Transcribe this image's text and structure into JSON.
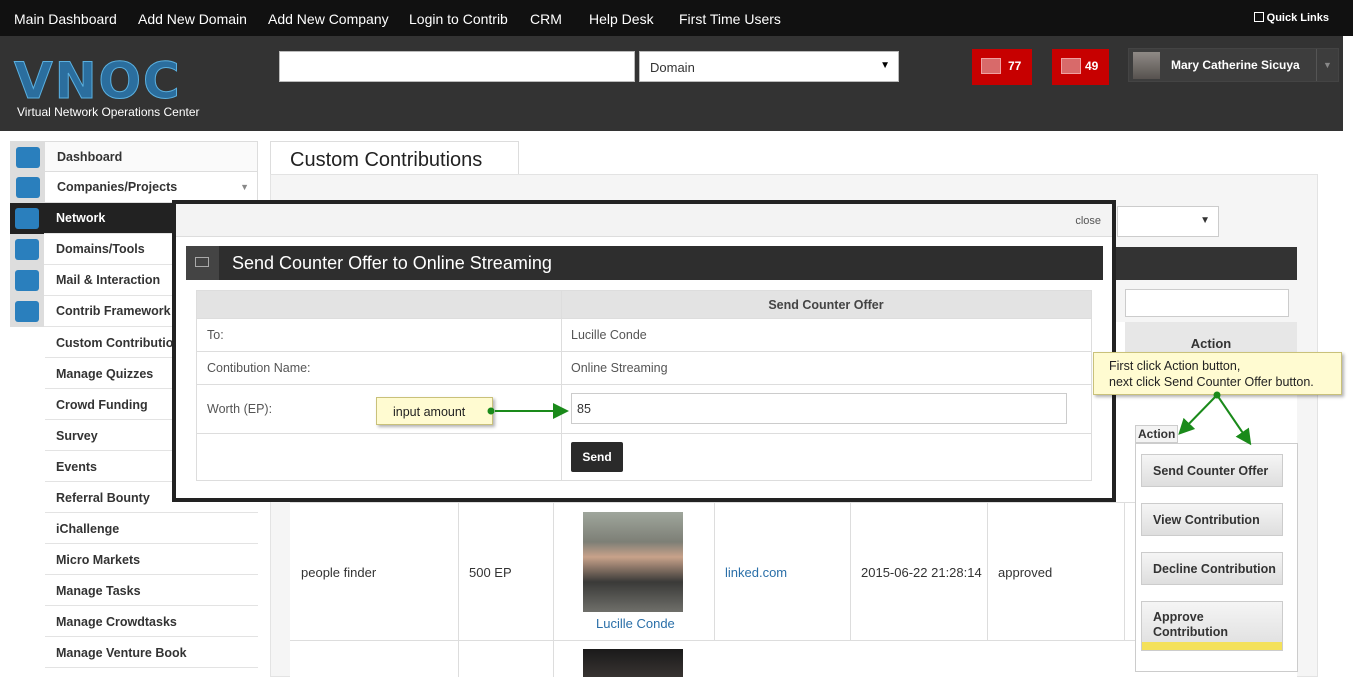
{
  "topnav": {
    "items": [
      "Main Dashboard",
      "Add New Domain",
      "Add New Company",
      "Login to Contrib",
      "CRM",
      "Help Desk",
      "First Time Users"
    ],
    "quick_links": "Quick Links"
  },
  "header": {
    "logo": "VNOC",
    "logo_sub": "Virtual Network Operations Center",
    "search_placeholder": "",
    "search_type": "Domain",
    "notif_tasks": "77",
    "notif_mail": "49",
    "user_name": "Mary Catherine Sicuya"
  },
  "sidebar": {
    "main": [
      "Dashboard",
      "Companies/Projects",
      "Network",
      "Domains/Tools",
      "Mail & Interaction",
      "Contrib Framework A"
    ],
    "sub": [
      "Custom Contributions",
      "Manage Quizzes",
      "Crowd Funding",
      "Survey",
      "Events",
      "Referral Bounty",
      "iChallenge",
      "Micro Markets",
      "Manage Tasks",
      "Manage Crowdtasks",
      "Manage Venture Book"
    ]
  },
  "page": {
    "title": "Custom Contributions",
    "action_header": "Action"
  },
  "row": {
    "name": "people finder",
    "worth": "500 EP",
    "member": "Lucille Conde",
    "domain": "linked.com",
    "date": "2015-06-22 21:28:14",
    "status": "approved"
  },
  "action_menu": {
    "button": "Action",
    "items": [
      "Send Counter Offer",
      "View Contribution",
      "Decline Contribution",
      "Approve Contribution"
    ]
  },
  "modal": {
    "close": "close",
    "title": "Send Counter Offer to Online Streaming",
    "column_header": "Send Counter Offer",
    "to_label": "To:",
    "to_value": "Lucille Conde",
    "name_label": "Contibution Name:",
    "name_value": "Online Streaming",
    "worth_label": "Worth (EP):",
    "worth_value": "85",
    "send": "Send"
  },
  "callouts": {
    "input_amount": "input amount",
    "instruction_line1": "First click Action button,",
    "instruction_line2": "next click Send Counter Offer button."
  },
  "colors": {
    "topnav": "#111111",
    "header": "#333333",
    "notif": "#c70000",
    "arrow": "#1a8a1a",
    "callout": "#fffbd1"
  }
}
